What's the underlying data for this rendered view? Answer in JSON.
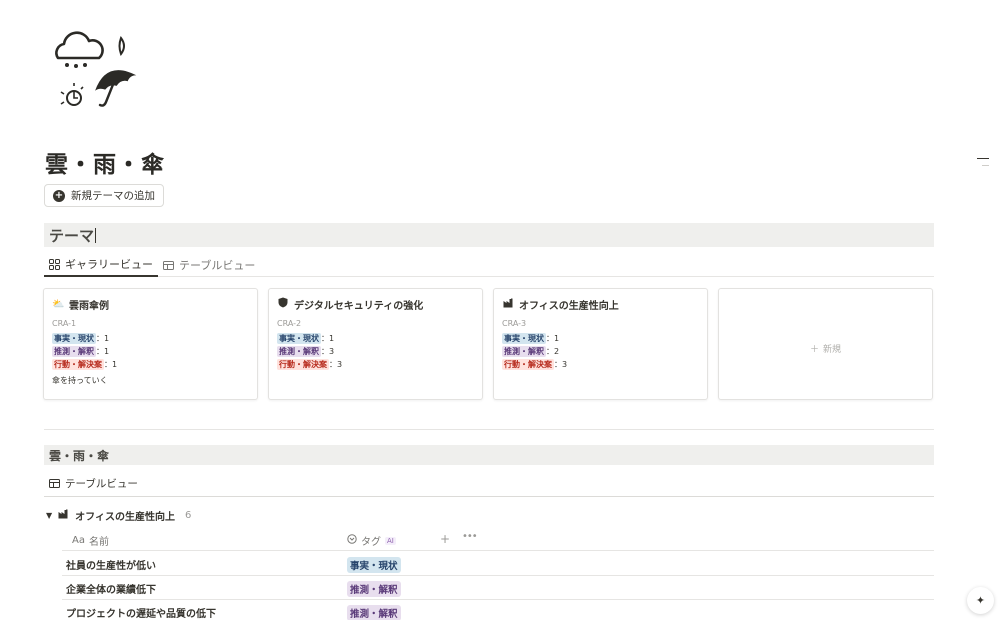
{
  "page": {
    "title": "雲・雨・傘",
    "icon": "cloud-rain-umbrella-icon",
    "add_theme_label": "新規テーマの追加"
  },
  "section1": {
    "heading": "テーマ",
    "tabs": [
      {
        "label": "ギャラリービュー",
        "icon": "gallery-icon",
        "active": true
      },
      {
        "label": "テーブルビュー",
        "icon": "table-icon",
        "active": false
      }
    ],
    "cards": [
      {
        "icon": "sun-cloud-icon",
        "title": "雲雨傘例",
        "id": "CRA-1",
        "fact_tag": "事実・現状",
        "fact_count": "：1",
        "guess_tag": "推測・解釈",
        "guess_count": "：1",
        "action_tag": "行動・解決案",
        "action_count": "：1",
        "note": "傘を持っていく"
      },
      {
        "icon": "shield-icon",
        "title": "デジタルセキュリティの強化",
        "id": "CRA-2",
        "fact_tag": "事実・現状",
        "fact_count": "：1",
        "guess_tag": "推測・解釈",
        "guess_count": "：3",
        "action_tag": "行動・解決案",
        "action_count": "：3",
        "note": ""
      },
      {
        "icon": "factory-icon",
        "title": "オフィスの生産性向上",
        "id": "CRA-3",
        "fact_tag": "事実・現状",
        "fact_count": "：1",
        "guess_tag": "推測・解釈",
        "guess_count": "：2",
        "action_tag": "行動・解決案",
        "action_count": "：3",
        "note": ""
      }
    ],
    "new_card_label": "新規"
  },
  "section2": {
    "heading": "雲・雨・傘",
    "tab_label": "テーブルビュー",
    "group": {
      "title": "オフィスの生産性向上",
      "count": "6"
    },
    "columns": {
      "name": "名前",
      "name_prefix": "Aa",
      "tag": "タグ",
      "ai_badge": "AI"
    },
    "rows": [
      {
        "name": "社員の生産性が低い",
        "tag": "事実・現状"
      },
      {
        "name": "企業全体の業績低下",
        "tag": "推測・解釈"
      },
      {
        "name": "プロジェクトの遅延や品質の低下",
        "tag": "推測・解釈"
      }
    ]
  },
  "colors": {
    "fact_bg": "#d3e5ef",
    "guess_bg": "#e8deee",
    "action_bg": "#ffe2dd"
  }
}
